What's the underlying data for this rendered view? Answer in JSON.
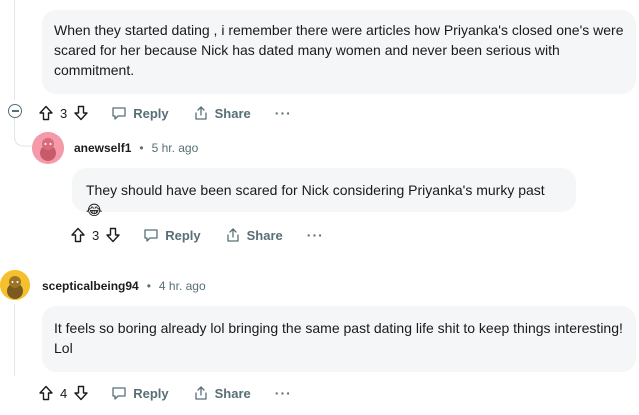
{
  "comment1": {
    "text": "When they started dating , i remember there were articles how Priyanka's closed one's were scared for her because Nick has dated many women and never been serious with commitment.",
    "votes": "3",
    "reply_label": "Reply",
    "share_label": "Share",
    "more_label": "···"
  },
  "comment2": {
    "username": "anewself1",
    "separator": "•",
    "time": "5 hr. ago",
    "text": "They should have been scared for Nick considering Priyanka's murky past 😂",
    "votes": "3",
    "reply_label": "Reply",
    "share_label": "Share",
    "more_label": "···"
  },
  "comment3": {
    "username": "scepticalbeing94",
    "separator": "•",
    "time": "4 hr. ago",
    "text": "It feels so boring already lol bringing the same past dating life shit to keep things interesting! Lol",
    "votes": "4",
    "reply_label": "Reply",
    "share_label": "Share",
    "more_label": "···"
  },
  "colors": {
    "bubble_bg": "#f5f6f8",
    "meta_text": "#576f76",
    "avatar_pink": "#f49aa9",
    "avatar_yellow": "#f4c02e"
  }
}
